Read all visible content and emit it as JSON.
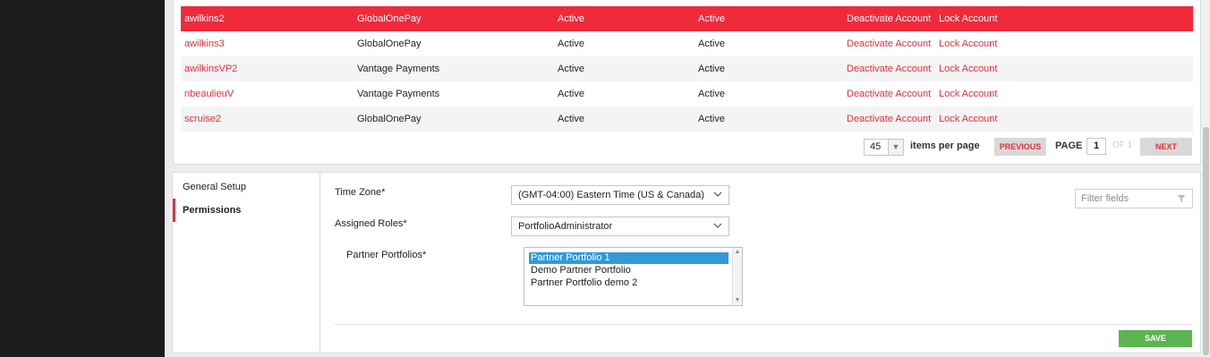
{
  "users_table": {
    "rows": [
      {
        "username": "awilkins2",
        "organization": "GlobalOnePay",
        "status1": "Active",
        "status2": "Active",
        "action1": "Deactivate Account",
        "action2": "Lock Account"
      },
      {
        "username": "awilkins3",
        "organization": "GlobalOnePay",
        "status1": "Active",
        "status2": "Active",
        "action1": "Deactivate Account",
        "action2": "Lock Account"
      },
      {
        "username": "awilkinsVP2",
        "organization": "Vantage Payments",
        "status1": "Active",
        "status2": "Active",
        "action1": "Deactivate Account",
        "action2": "Lock Account"
      },
      {
        "username": "nbeaulieuV",
        "organization": "Vantage Payments",
        "status1": "Active",
        "status2": "Active",
        "action1": "Deactivate Account",
        "action2": "Lock Account"
      },
      {
        "username": "scruise2",
        "organization": "GlobalOnePay",
        "status1": "Active",
        "status2": "Active",
        "action1": "Deactivate Account",
        "action2": "Lock Account"
      }
    ],
    "selected_row_color": "#ee2a3b"
  },
  "pagination": {
    "per_page_value": "45",
    "per_page_label": "items per page",
    "previous_label": "PREVIOUS",
    "page_label": "PAGE",
    "current_page": "1",
    "of_label": "OF 1",
    "next_label": "NEXT"
  },
  "side_nav": {
    "items": [
      {
        "label": "General Setup"
      },
      {
        "label": "Permissions"
      }
    ],
    "active_item": "Permissions"
  },
  "form": {
    "time_zone_label": "Time Zone*",
    "time_zone_value": "(GMT-04:00) Eastern Time (US & Canada)",
    "roles_label": "Assigned Roles*",
    "roles_value": "PortfolioAdministrator",
    "portfolios_label": "Partner Portfolios*",
    "portfolio_options": [
      "Partner Portfolio 1",
      "Demo Partner Portfolio",
      "Partner Portfolio demo 2"
    ],
    "selected_portfolio": "Partner Portfolio 1",
    "filter_placeholder": "Filter fields",
    "save_label": "SAVE"
  },
  "colors": {
    "accent_red": "#e0313f",
    "save_green": "#5bb550",
    "listbox_selection": "#3399d6"
  },
  "icons": [
    "chevron-down-icon",
    "filter-icon"
  ]
}
